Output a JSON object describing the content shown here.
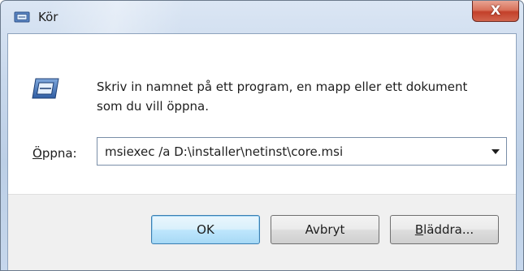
{
  "window": {
    "title": "Kör",
    "close_label": "X"
  },
  "main": {
    "description_line1": "Skriv in namnet på ett program, en mapp eller ett dokument",
    "description_line2": "som du vill öppna.",
    "open_label_mnemonic": "Ö",
    "open_label_rest": "ppna:",
    "open_value": "msiexec /a D:\\installer\\netinst\\core.msi"
  },
  "buttons": {
    "ok": "OK",
    "cancel": "Avbryt",
    "browse_mnemonic": "B",
    "browse_rest": "läddra..."
  },
  "icons": {
    "title": "run-icon",
    "main": "run-icon",
    "dropdown": "chevron-down-icon"
  },
  "colors": {
    "accent": "#3c7fb1",
    "close": "#c3402a"
  }
}
